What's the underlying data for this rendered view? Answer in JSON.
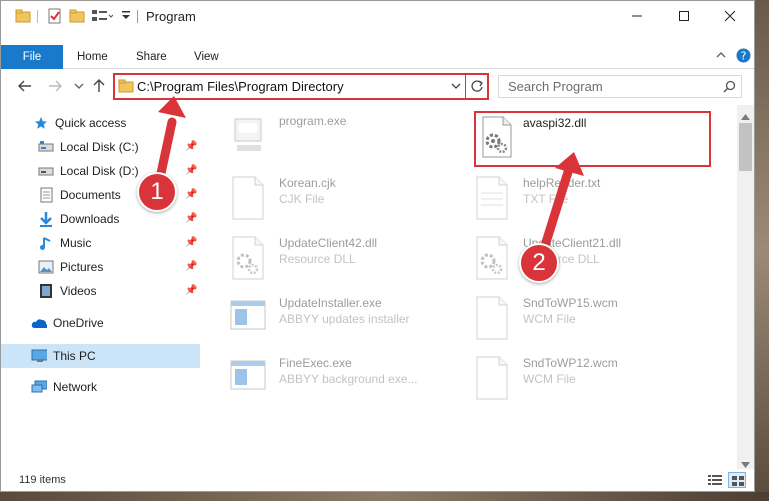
{
  "window": {
    "title": "Program"
  },
  "ribbon": {
    "tabs": [
      "File",
      "Home",
      "Share",
      "View"
    ]
  },
  "address": {
    "path": "C:\\Program Files\\Program Directory"
  },
  "search": {
    "placeholder": "Search Program"
  },
  "sidebar": {
    "items": [
      {
        "label": "Quick access",
        "icon": "star-icon",
        "pinned": false
      },
      {
        "label": "Local Disk (C:)",
        "icon": "drive-icon",
        "pinned": true
      },
      {
        "label": "Local Disk (D:)",
        "icon": "drive-icon",
        "pinned": true
      },
      {
        "label": "Documents",
        "icon": "documents-icon",
        "pinned": true
      },
      {
        "label": "Downloads",
        "icon": "downloads-icon",
        "pinned": true
      },
      {
        "label": "Music",
        "icon": "music-icon",
        "pinned": true
      },
      {
        "label": "Pictures",
        "icon": "pictures-icon",
        "pinned": true
      },
      {
        "label": "Videos",
        "icon": "videos-icon",
        "pinned": true
      },
      {
        "label": "OneDrive",
        "icon": "onedrive-icon",
        "pinned": false
      },
      {
        "label": "This PC",
        "icon": "this-pc-icon",
        "pinned": false,
        "selected": true
      },
      {
        "label": "Network",
        "icon": "network-icon",
        "pinned": false
      }
    ]
  },
  "files": [
    {
      "name": "program.exe",
      "desc": "",
      "icon": "exe-icon"
    },
    {
      "name": "avaspi32.dll",
      "desc": "",
      "icon": "dll-gear-icon",
      "highlighted": true
    },
    {
      "name": "Korean.cjk",
      "desc": "CJK File",
      "icon": "blank-file-icon"
    },
    {
      "name": "helpReader.txt",
      "desc": "TXT File",
      "icon": "blank-file-icon"
    },
    {
      "name": "UpdateClient42.dll",
      "desc": "Resource DLL",
      "icon": "dll-gear-icon"
    },
    {
      "name": "UpdateClient21.dll",
      "desc": "Resource DLL",
      "icon": "dll-gear-icon"
    },
    {
      "name": "UpdateInstaller.exe",
      "desc": "ABBYY updates installer",
      "icon": "window-exe-icon"
    },
    {
      "name": "SndToWP15.wcm",
      "desc": "WCM File",
      "icon": "blank-file-icon"
    },
    {
      "name": "FineExec.exe",
      "desc": "ABBYY background exe...",
      "icon": "window-exe-icon"
    },
    {
      "name": "SndToWP12.wcm",
      "desc": "WCM File",
      "icon": "blank-file-icon"
    }
  ],
  "status": {
    "count": "119 items"
  },
  "callouts": {
    "one": "1",
    "two": "2"
  },
  "colors": {
    "accent": "#1979ca",
    "annotation": "#d9343a",
    "selection": "#cce4f7"
  }
}
